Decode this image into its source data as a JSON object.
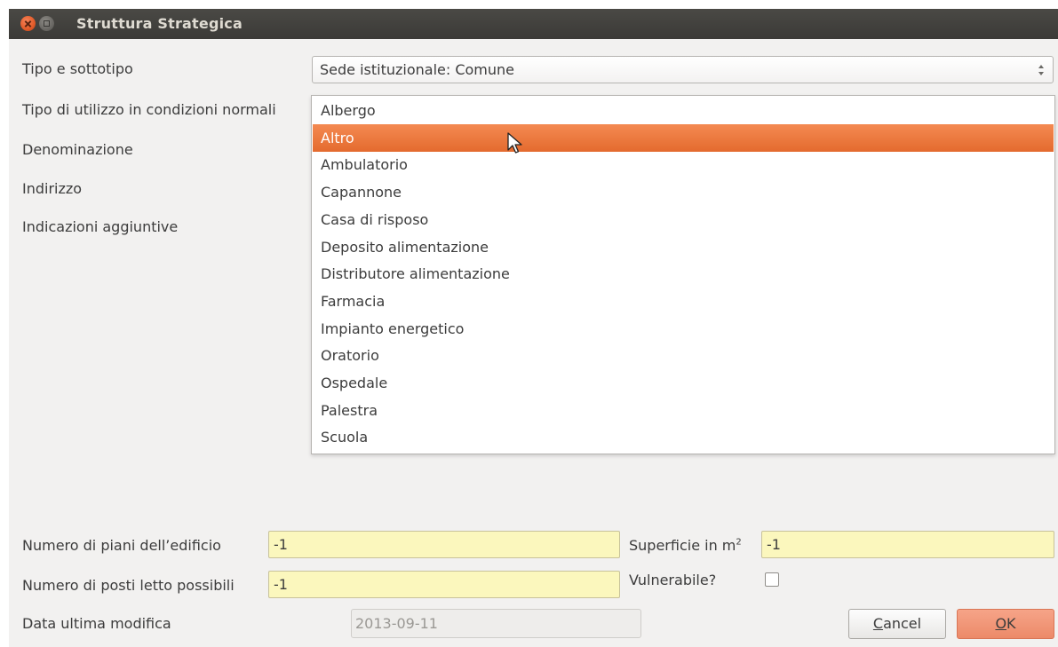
{
  "window": {
    "title": "Struttura Strategica"
  },
  "form": {
    "tipo_label": "Tipo e sottotipo",
    "tipo_value": "Sede istituzionale: Comune",
    "utilizzo_label": "Tipo di utilizzo in condizioni normali",
    "denominazione_label": "Denominazione",
    "indirizzo_label": "Indirizzo",
    "indicazioni_label": "Indicazioni aggiuntive",
    "piani_label": "Numero di piani dell’edificio",
    "piani_value": "-1",
    "superficie_label": "Superficie in m",
    "superficie_sup": "2",
    "superficie_value": "-1",
    "posti_label": "Numero di posti letto possibili",
    "posti_value": "-1",
    "vulnerabile_label": "Vulnerabile?",
    "vulnerabile_checked": false,
    "data_label": "Data ultima modifica",
    "data_value": "2013-09-11"
  },
  "dropdown": {
    "selected_index": 1,
    "items": [
      "Albergo",
      "Altro",
      "Ambulatorio",
      "Capannone",
      "Casa di risposo",
      "Deposito alimentazione",
      "Distributore alimentazione",
      "Farmacia",
      "Impianto energetico",
      "Oratorio",
      "Ospedale",
      "Palestra",
      "Scuola"
    ]
  },
  "buttons": {
    "cancel_first": "C",
    "cancel_rest": "ancel",
    "ok_first": "O",
    "ok_rest": "K"
  },
  "colors": {
    "selection": "#e8703a",
    "ok_button": "#f09878",
    "field_yellow": "#fbf7bd",
    "titlebar": "#403f3b"
  }
}
